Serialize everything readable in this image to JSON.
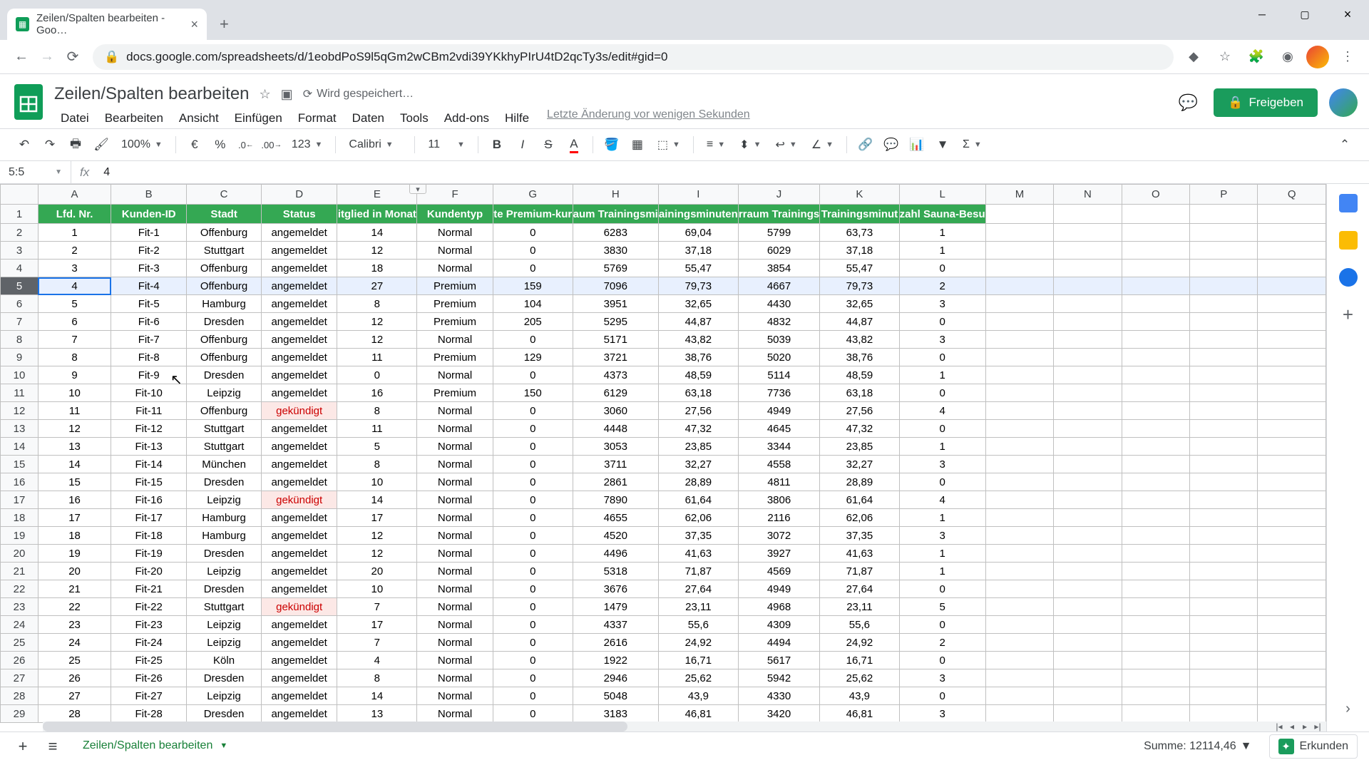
{
  "browser": {
    "tab_title": "Zeilen/Spalten bearbeiten - Goo…",
    "url": "docs.google.com/spreadsheets/d/1eobdPoS9l5qGm2wCBm2vdi39YKkhyPIrU4tD2qcTy3s/edit#gid=0"
  },
  "doc": {
    "title": "Zeilen/Spalten bearbeiten",
    "save_status": "Wird gespeichert…",
    "last_edit": "Letzte Änderung vor wenigen Sekunden"
  },
  "menus": [
    "Datei",
    "Bearbeiten",
    "Ansicht",
    "Einfügen",
    "Format",
    "Daten",
    "Tools",
    "Add-ons",
    "Hilfe"
  ],
  "share_label": "Freigeben",
  "toolbar": {
    "zoom": "100%",
    "currency": "€",
    "percent": "%",
    "dec_less": ".0",
    "dec_more": ".00",
    "format_num": "123",
    "font": "Calibri",
    "font_size": "11"
  },
  "formula": {
    "name_box": "5:5",
    "fx": "fx",
    "value": "4"
  },
  "columns_letters": [
    "A",
    "B",
    "C",
    "D",
    "E",
    "F",
    "G",
    "H",
    "I",
    "J",
    "K",
    "L",
    "M",
    "N",
    "O",
    "P",
    "Q"
  ],
  "headers": [
    "Lfd. Nr.",
    "Kunden-ID",
    "Stadt",
    "Status",
    "itglied in Monat",
    "Kundentyp",
    "te Premium-kur",
    "aum Trainingsmi",
    "ainingsminuten",
    "rraum Trainings",
    "Trainingsminut",
    "zahl Sauna-Besu"
  ],
  "selected_row_index": 5,
  "rows": [
    [
      1,
      "Fit-1",
      "Offenburg",
      "angemeldet",
      14,
      "Normal",
      0,
      6283,
      "69,04",
      5799,
      "63,73",
      1
    ],
    [
      2,
      "Fit-2",
      "Stuttgart",
      "angemeldet",
      12,
      "Normal",
      0,
      3830,
      "37,18",
      6029,
      "37,18",
      1
    ],
    [
      3,
      "Fit-3",
      "Offenburg",
      "angemeldet",
      18,
      "Normal",
      0,
      5769,
      "55,47",
      3854,
      "55,47",
      0
    ],
    [
      4,
      "Fit-4",
      "Offenburg",
      "angemeldet",
      27,
      "Premium",
      159,
      7096,
      "79,73",
      4667,
      "79,73",
      2
    ],
    [
      5,
      "Fit-5",
      "Hamburg",
      "angemeldet",
      8,
      "Premium",
      104,
      3951,
      "32,65",
      4430,
      "32,65",
      3
    ],
    [
      6,
      "Fit-6",
      "Dresden",
      "angemeldet",
      12,
      "Premium",
      205,
      5295,
      "44,87",
      4832,
      "44,87",
      0
    ],
    [
      7,
      "Fit-7",
      "Offenburg",
      "angemeldet",
      12,
      "Normal",
      0,
      5171,
      "43,82",
      5039,
      "43,82",
      3
    ],
    [
      8,
      "Fit-8",
      "Offenburg",
      "angemeldet",
      11,
      "Premium",
      129,
      3721,
      "38,76",
      5020,
      "38,76",
      0
    ],
    [
      9,
      "Fit-9",
      "Dresden",
      "angemeldet",
      0,
      "Normal",
      0,
      4373,
      "48,59",
      5114,
      "48,59",
      1
    ],
    [
      10,
      "Fit-10",
      "Leipzig",
      "angemeldet",
      16,
      "Premium",
      150,
      6129,
      "63,18",
      7736,
      "63,18",
      0
    ],
    [
      11,
      "Fit-11",
      "Offenburg",
      "gekündigt",
      8,
      "Normal",
      0,
      3060,
      "27,56",
      4949,
      "27,56",
      4
    ],
    [
      12,
      "Fit-12",
      "Stuttgart",
      "angemeldet",
      11,
      "Normal",
      0,
      4448,
      "47,32",
      4645,
      "47,32",
      0
    ],
    [
      13,
      "Fit-13",
      "Stuttgart",
      "angemeldet",
      5,
      "Normal",
      0,
      3053,
      "23,85",
      3344,
      "23,85",
      1
    ],
    [
      14,
      "Fit-14",
      "München",
      "angemeldet",
      8,
      "Normal",
      0,
      3711,
      "32,27",
      4558,
      "32,27",
      3
    ],
    [
      15,
      "Fit-15",
      "Dresden",
      "angemeldet",
      10,
      "Normal",
      0,
      2861,
      "28,89",
      4811,
      "28,89",
      0
    ],
    [
      16,
      "Fit-16",
      "Leipzig",
      "gekündigt",
      14,
      "Normal",
      0,
      7890,
      "61,64",
      3806,
      "61,64",
      4
    ],
    [
      17,
      "Fit-17",
      "Hamburg",
      "angemeldet",
      17,
      "Normal",
      0,
      4655,
      "62,06",
      2116,
      "62,06",
      1
    ],
    [
      18,
      "Fit-18",
      "Hamburg",
      "angemeldet",
      12,
      "Normal",
      0,
      4520,
      "37,35",
      3072,
      "37,35",
      3
    ],
    [
      19,
      "Fit-19",
      "Dresden",
      "angemeldet",
      12,
      "Normal",
      0,
      4496,
      "41,63",
      3927,
      "41,63",
      1
    ],
    [
      20,
      "Fit-20",
      "Leipzig",
      "angemeldet",
      20,
      "Normal",
      0,
      5318,
      "71,87",
      4569,
      "71,87",
      1
    ],
    [
      21,
      "Fit-21",
      "Dresden",
      "angemeldet",
      10,
      "Normal",
      0,
      3676,
      "27,64",
      4949,
      "27,64",
      0
    ],
    [
      22,
      "Fit-22",
      "Stuttgart",
      "gekündigt",
      7,
      "Normal",
      0,
      1479,
      "23,11",
      4968,
      "23,11",
      5
    ],
    [
      23,
      "Fit-23",
      "Leipzig",
      "angemeldet",
      17,
      "Normal",
      0,
      4337,
      "55,6",
      4309,
      "55,6",
      0
    ],
    [
      24,
      "Fit-24",
      "Leipzig",
      "angemeldet",
      7,
      "Normal",
      0,
      2616,
      "24,92",
      4494,
      "24,92",
      2
    ],
    [
      25,
      "Fit-25",
      "Köln",
      "angemeldet",
      4,
      "Normal",
      0,
      1922,
      "16,71",
      5617,
      "16,71",
      0
    ],
    [
      26,
      "Fit-26",
      "Dresden",
      "angemeldet",
      8,
      "Normal",
      0,
      2946,
      "25,62",
      5942,
      "25,62",
      3
    ],
    [
      27,
      "Fit-27",
      "Leipzig",
      "angemeldet",
      14,
      "Normal",
      0,
      5048,
      "43,9",
      4330,
      "43,9",
      0
    ],
    [
      28,
      "Fit-28",
      "Dresden",
      "angemeldet",
      13,
      "Normal",
      0,
      3183,
      "46,81",
      3420,
      "46,81",
      3
    ]
  ],
  "sheet_tab": "Zeilen/Spalten bearbeiten",
  "bottom": {
    "sum_label": "Summe: 12114,46",
    "explore": "Erkunden"
  }
}
